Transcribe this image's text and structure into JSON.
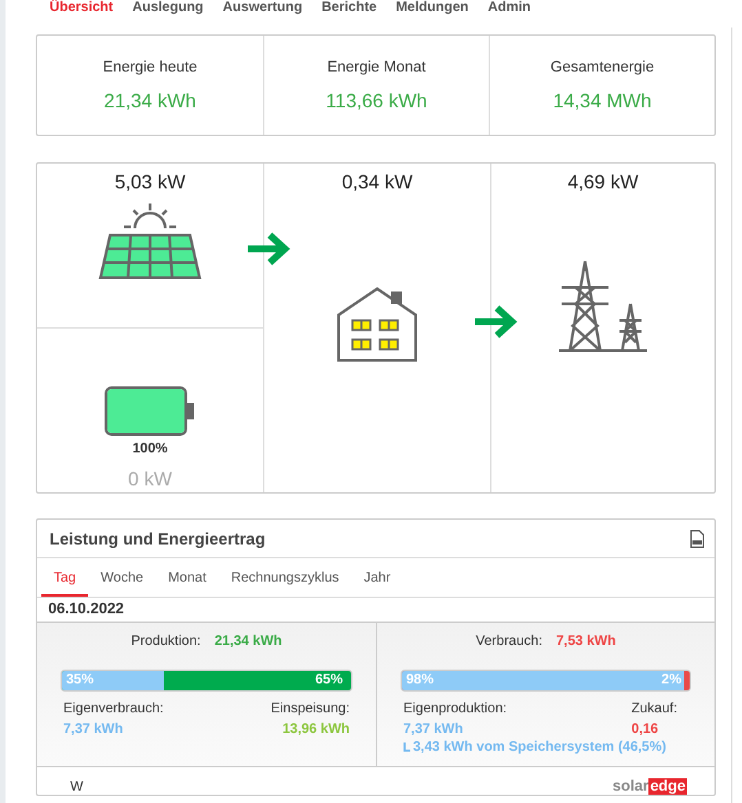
{
  "nav": [
    {
      "label": "Übersicht",
      "selected": true
    },
    {
      "label": "Auslegung",
      "selected": false
    },
    {
      "label": "Auswertung",
      "selected": false
    },
    {
      "label": "Berichte",
      "selected": false
    },
    {
      "label": "Meldungen",
      "selected": false
    },
    {
      "label": "Admin",
      "selected": false
    }
  ],
  "stats": [
    {
      "label": "Energie heute",
      "value": "21,34 kWh"
    },
    {
      "label": "Energie Monat",
      "value": "113,66 kWh"
    },
    {
      "label": "Gesamtenergie",
      "value": "14,34 MWh"
    }
  ],
  "flow": {
    "pv": {
      "power": "5,03 kW"
    },
    "battery": {
      "level": 1.0,
      "percent": "100%",
      "power": "0 kW"
    },
    "house": {
      "power": "0,34 kW"
    },
    "grid": {
      "power": "4,69 kW"
    },
    "pv_to_house": true,
    "house_to_grid": true
  },
  "energy": {
    "title": "Leistung und Energieertrag",
    "tabs": [
      {
        "label": "Tag",
        "selected": true
      },
      {
        "label": "Woche",
        "selected": false
      },
      {
        "label": "Monat",
        "selected": false
      },
      {
        "label": "Rechnungszyklus",
        "selected": false
      },
      {
        "label": "Jahr",
        "selected": false
      }
    ],
    "date": "06.10.2022",
    "production": {
      "label": "Produktion:",
      "value": "21,34 kWh",
      "level": 0.35,
      "left_pct": "35%",
      "right_pct": "65%",
      "left_label": "Eigenverbrauch:",
      "left_value": "7,37 kWh",
      "right_label": "Einspeisung:",
      "right_value": "13,96 kWh"
    },
    "consumption": {
      "label": "Verbrauch:",
      "value": "7,53 kWh",
      "level": 0.98,
      "left_pct": "98%",
      "right_pct": "2%",
      "left_label": "Eigenproduktion:",
      "left_value": "7,37 kWh",
      "right_label": "Zukauf:",
      "right_value": "0,16",
      "note": "3,43 kWh vom Speichersystem (46,5%)"
    },
    "axis_unit": "W",
    "logo": {
      "text": "solar",
      "highlight": "edge"
    }
  }
}
